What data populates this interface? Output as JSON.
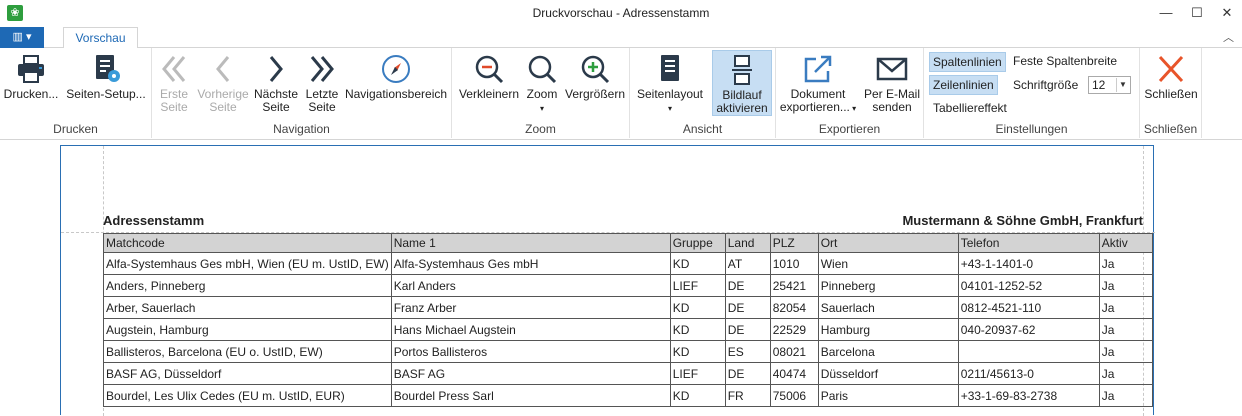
{
  "window": {
    "title": "Druckvorschau - Adressenstamm"
  },
  "tabs": {
    "preview": "Vorschau"
  },
  "groups": {
    "drucken": {
      "label": "Drucken",
      "print": "Drucken...",
      "setup": "Seiten-Setup..."
    },
    "navigation": {
      "label": "Navigation",
      "first_l1": "Erste",
      "first_l2": "Seite",
      "prev_l1": "Vorherige",
      "prev_l2": "Seite",
      "next_l1": "Nächste",
      "next_l2": "Seite",
      "last_l1": "Letzte",
      "last_l2": "Seite",
      "nav_area": "Navigationsbereich"
    },
    "zoom": {
      "label": "Zoom",
      "zoom_out": "Verkleinern",
      "zoom": "Zoom",
      "zoom_in": "Vergrößern"
    },
    "ansicht": {
      "label": "Ansicht",
      "layout": "Seitenlayout",
      "scroll_l1": "Bildlauf",
      "scroll_l2": "aktivieren"
    },
    "export": {
      "label": "Exportieren",
      "doc_l1": "Dokument",
      "doc_l2": "exportieren...",
      "mail_l1": "Per E-Mail",
      "mail_l2": "senden"
    },
    "settings": {
      "label": "Einstellungen",
      "col_lines": "Spaltenlinien",
      "row_lines": "Zeilenlinien",
      "table_effect": "Tabelliereffekt",
      "fixed_width": "Feste Spaltenbreite",
      "font_size_label": "Schriftgröße",
      "font_size_value": "12"
    },
    "close": {
      "label": "Schließen",
      "close": "Schließen"
    }
  },
  "report": {
    "title": "Adressenstamm",
    "company": "Mustermann & Söhne GmbH, Frankfurt",
    "columns": [
      "Matchcode",
      "Name 1",
      "Gruppe",
      "Land",
      "PLZ",
      "Ort",
      "Telefon",
      "Aktiv"
    ],
    "rows": [
      [
        "Alfa-Systemhaus Ges mbH, Wien (EU m. UstID, EW)",
        "Alfa-Systemhaus Ges mbH",
        "KD",
        "AT",
        "1010",
        "Wien",
        "+43-1-1401-0",
        "Ja"
      ],
      [
        "Anders, Pinneberg",
        "Karl Anders",
        "LIEF",
        "DE",
        "25421",
        "Pinneberg",
        "04101-1252-52",
        "Ja"
      ],
      [
        "Arber, Sauerlach",
        "Franz Arber",
        "KD",
        "DE",
        "82054",
        "Sauerlach",
        "0812-4521-110",
        "Ja"
      ],
      [
        "Augstein, Hamburg",
        "Hans Michael Augstein",
        "KD",
        "DE",
        "22529",
        "Hamburg",
        "040-20937-62",
        "Ja"
      ],
      [
        "Ballisteros, Barcelona (EU o. UstID, EW)",
        "Portos Ballisteros",
        "KD",
        "ES",
        "08021",
        "Barcelona",
        "",
        "Ja"
      ],
      [
        "BASF AG, Düsseldorf",
        "BASF AG",
        "LIEF",
        "DE",
        "40474",
        "Düsseldorf",
        "0211/45613-0",
        "Ja"
      ],
      [
        "Bourdel, Les Ulix Cedes (EU m. UstID, EUR)",
        "Bourdel Press Sarl",
        "KD",
        "FR",
        "75006",
        "Paris",
        "+33-1-69-83-2738",
        "Ja"
      ]
    ]
  }
}
